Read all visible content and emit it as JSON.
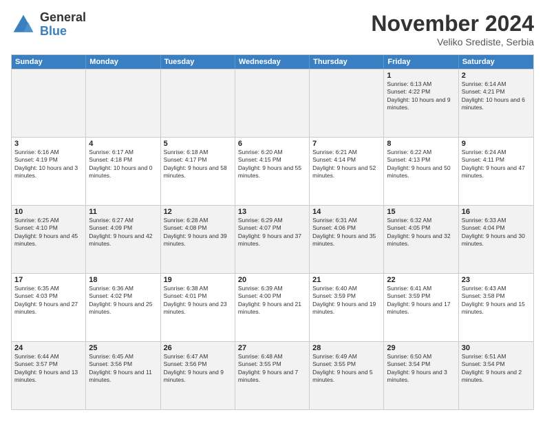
{
  "logo": {
    "general": "General",
    "blue": "Blue"
  },
  "header": {
    "month": "November 2024",
    "location": "Veliko Srediste, Serbia"
  },
  "weekdays": [
    "Sunday",
    "Monday",
    "Tuesday",
    "Wednesday",
    "Thursday",
    "Friday",
    "Saturday"
  ],
  "rows": [
    [
      {
        "day": "",
        "info": ""
      },
      {
        "day": "",
        "info": ""
      },
      {
        "day": "",
        "info": ""
      },
      {
        "day": "",
        "info": ""
      },
      {
        "day": "",
        "info": ""
      },
      {
        "day": "1",
        "info": "Sunrise: 6:13 AM\nSunset: 4:22 PM\nDaylight: 10 hours and 9 minutes."
      },
      {
        "day": "2",
        "info": "Sunrise: 6:14 AM\nSunset: 4:21 PM\nDaylight: 10 hours and 6 minutes."
      }
    ],
    [
      {
        "day": "3",
        "info": "Sunrise: 6:16 AM\nSunset: 4:19 PM\nDaylight: 10 hours and 3 minutes."
      },
      {
        "day": "4",
        "info": "Sunrise: 6:17 AM\nSunset: 4:18 PM\nDaylight: 10 hours and 0 minutes."
      },
      {
        "day": "5",
        "info": "Sunrise: 6:18 AM\nSunset: 4:17 PM\nDaylight: 9 hours and 58 minutes."
      },
      {
        "day": "6",
        "info": "Sunrise: 6:20 AM\nSunset: 4:15 PM\nDaylight: 9 hours and 55 minutes."
      },
      {
        "day": "7",
        "info": "Sunrise: 6:21 AM\nSunset: 4:14 PM\nDaylight: 9 hours and 52 minutes."
      },
      {
        "day": "8",
        "info": "Sunrise: 6:22 AM\nSunset: 4:13 PM\nDaylight: 9 hours and 50 minutes."
      },
      {
        "day": "9",
        "info": "Sunrise: 6:24 AM\nSunset: 4:11 PM\nDaylight: 9 hours and 47 minutes."
      }
    ],
    [
      {
        "day": "10",
        "info": "Sunrise: 6:25 AM\nSunset: 4:10 PM\nDaylight: 9 hours and 45 minutes."
      },
      {
        "day": "11",
        "info": "Sunrise: 6:27 AM\nSunset: 4:09 PM\nDaylight: 9 hours and 42 minutes."
      },
      {
        "day": "12",
        "info": "Sunrise: 6:28 AM\nSunset: 4:08 PM\nDaylight: 9 hours and 39 minutes."
      },
      {
        "day": "13",
        "info": "Sunrise: 6:29 AM\nSunset: 4:07 PM\nDaylight: 9 hours and 37 minutes."
      },
      {
        "day": "14",
        "info": "Sunrise: 6:31 AM\nSunset: 4:06 PM\nDaylight: 9 hours and 35 minutes."
      },
      {
        "day": "15",
        "info": "Sunrise: 6:32 AM\nSunset: 4:05 PM\nDaylight: 9 hours and 32 minutes."
      },
      {
        "day": "16",
        "info": "Sunrise: 6:33 AM\nSunset: 4:04 PM\nDaylight: 9 hours and 30 minutes."
      }
    ],
    [
      {
        "day": "17",
        "info": "Sunrise: 6:35 AM\nSunset: 4:03 PM\nDaylight: 9 hours and 27 minutes."
      },
      {
        "day": "18",
        "info": "Sunrise: 6:36 AM\nSunset: 4:02 PM\nDaylight: 9 hours and 25 minutes."
      },
      {
        "day": "19",
        "info": "Sunrise: 6:38 AM\nSunset: 4:01 PM\nDaylight: 9 hours and 23 minutes."
      },
      {
        "day": "20",
        "info": "Sunrise: 6:39 AM\nSunset: 4:00 PM\nDaylight: 9 hours and 21 minutes."
      },
      {
        "day": "21",
        "info": "Sunrise: 6:40 AM\nSunset: 3:59 PM\nDaylight: 9 hours and 19 minutes."
      },
      {
        "day": "22",
        "info": "Sunrise: 6:41 AM\nSunset: 3:59 PM\nDaylight: 9 hours and 17 minutes."
      },
      {
        "day": "23",
        "info": "Sunrise: 6:43 AM\nSunset: 3:58 PM\nDaylight: 9 hours and 15 minutes."
      }
    ],
    [
      {
        "day": "24",
        "info": "Sunrise: 6:44 AM\nSunset: 3:57 PM\nDaylight: 9 hours and 13 minutes."
      },
      {
        "day": "25",
        "info": "Sunrise: 6:45 AM\nSunset: 3:56 PM\nDaylight: 9 hours and 11 minutes."
      },
      {
        "day": "26",
        "info": "Sunrise: 6:47 AM\nSunset: 3:56 PM\nDaylight: 9 hours and 9 minutes."
      },
      {
        "day": "27",
        "info": "Sunrise: 6:48 AM\nSunset: 3:55 PM\nDaylight: 9 hours and 7 minutes."
      },
      {
        "day": "28",
        "info": "Sunrise: 6:49 AM\nSunset: 3:55 PM\nDaylight: 9 hours and 5 minutes."
      },
      {
        "day": "29",
        "info": "Sunrise: 6:50 AM\nSunset: 3:54 PM\nDaylight: 9 hours and 3 minutes."
      },
      {
        "day": "30",
        "info": "Sunrise: 6:51 AM\nSunset: 3:54 PM\nDaylight: 9 hours and 2 minutes."
      }
    ]
  ],
  "alt_rows": [
    0,
    2,
    4
  ]
}
